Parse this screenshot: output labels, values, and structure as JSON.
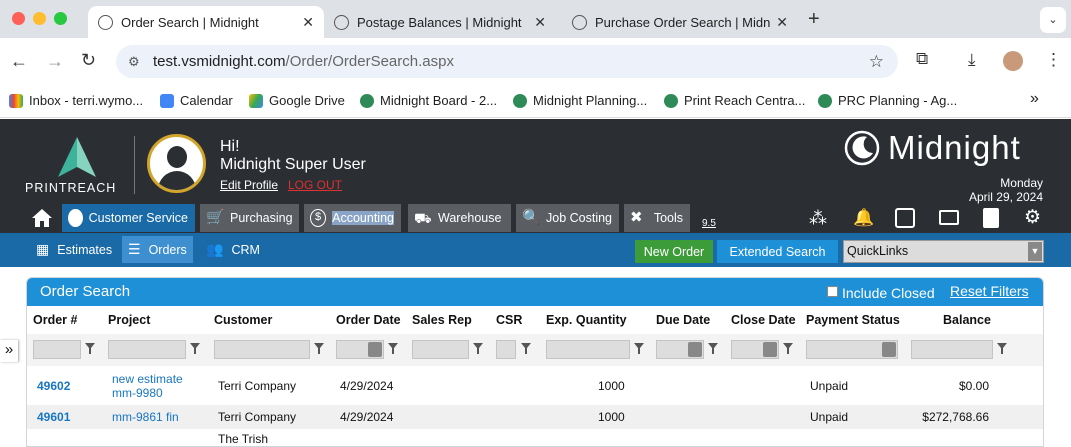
{
  "browser": {
    "tabs": [
      {
        "title": "Order Search | Midnight",
        "active": true
      },
      {
        "title": "Postage Balances | Midnight",
        "active": false
      },
      {
        "title": "Purchase Order Search | Midn",
        "active": false
      }
    ],
    "new_tab_label": "+",
    "url_host": "test.vsmidnight.com",
    "url_path": "/Order/OrderSearch.aspx",
    "bookmarks": [
      {
        "label": "Inbox - terri.wymo...",
        "icon": "gmail-icon"
      },
      {
        "label": "Calendar",
        "icon": "calendar-icon"
      },
      {
        "label": "Google Drive",
        "icon": "drive-icon"
      },
      {
        "label": "Midnight Board - 2...",
        "icon": "midnight-icon"
      },
      {
        "label": "Midnight Planning...",
        "icon": "midnight-icon"
      },
      {
        "label": "Print Reach Centra...",
        "icon": "midnight-icon"
      },
      {
        "label": "PRC Planning - Ag...",
        "icon": "midnight-icon"
      }
    ],
    "more_bookmarks": "»"
  },
  "app": {
    "brand_text": "PRINTREACH",
    "logo_text": "Midnight",
    "greeting": "Hi!",
    "user_name": "Midnight Super User",
    "edit_profile": "Edit Profile",
    "logout": "LOG OUT",
    "day": "Monday",
    "date": "April 29, 2024",
    "version": "9.5",
    "menu": [
      "Customer Service",
      "Purchasing",
      "Accounting",
      "Warehouse",
      "Job Costing",
      "Tools"
    ],
    "subnav": [
      "Estimates",
      "Orders",
      "CRM"
    ],
    "new_order": "New Order",
    "extended_search": "Extended Search",
    "quicklinks": "QuickLinks"
  },
  "panel": {
    "title": "Order Search",
    "include_closed": "Include Closed",
    "reset_filters": "Reset Filters",
    "side_toggle": "»",
    "columns": [
      "Order #",
      "Project",
      "Customer",
      "Order Date",
      "Sales Rep",
      "CSR",
      "Exp. Quantity",
      "Due Date",
      "Close Date",
      "Payment Status",
      "Balance"
    ],
    "rows": [
      {
        "order": "49602",
        "project_line1": "new estimate",
        "project_line2": "mm-9980",
        "customer": "Terri Company",
        "date": "4/29/2024",
        "qty": "1000",
        "status": "Unpaid",
        "balance": "$0.00"
      },
      {
        "order": "49601",
        "project_line1": "mm-9861 fin",
        "project_line2": "",
        "customer": "Terri Company",
        "date": "4/29/2024",
        "qty": "1000",
        "status": "Unpaid",
        "balance": "$272,768.66"
      },
      {
        "order": "",
        "project_line1": "",
        "project_line2": "",
        "customer": "The Trish",
        "date": "",
        "qty": "",
        "status": "",
        "balance": ""
      }
    ]
  },
  "colors": {
    "accent": "#1e90d8",
    "header": "#2b2e33",
    "nav": "#1a6aa8",
    "green": "#3d9c3a",
    "logout": "#e03030"
  }
}
